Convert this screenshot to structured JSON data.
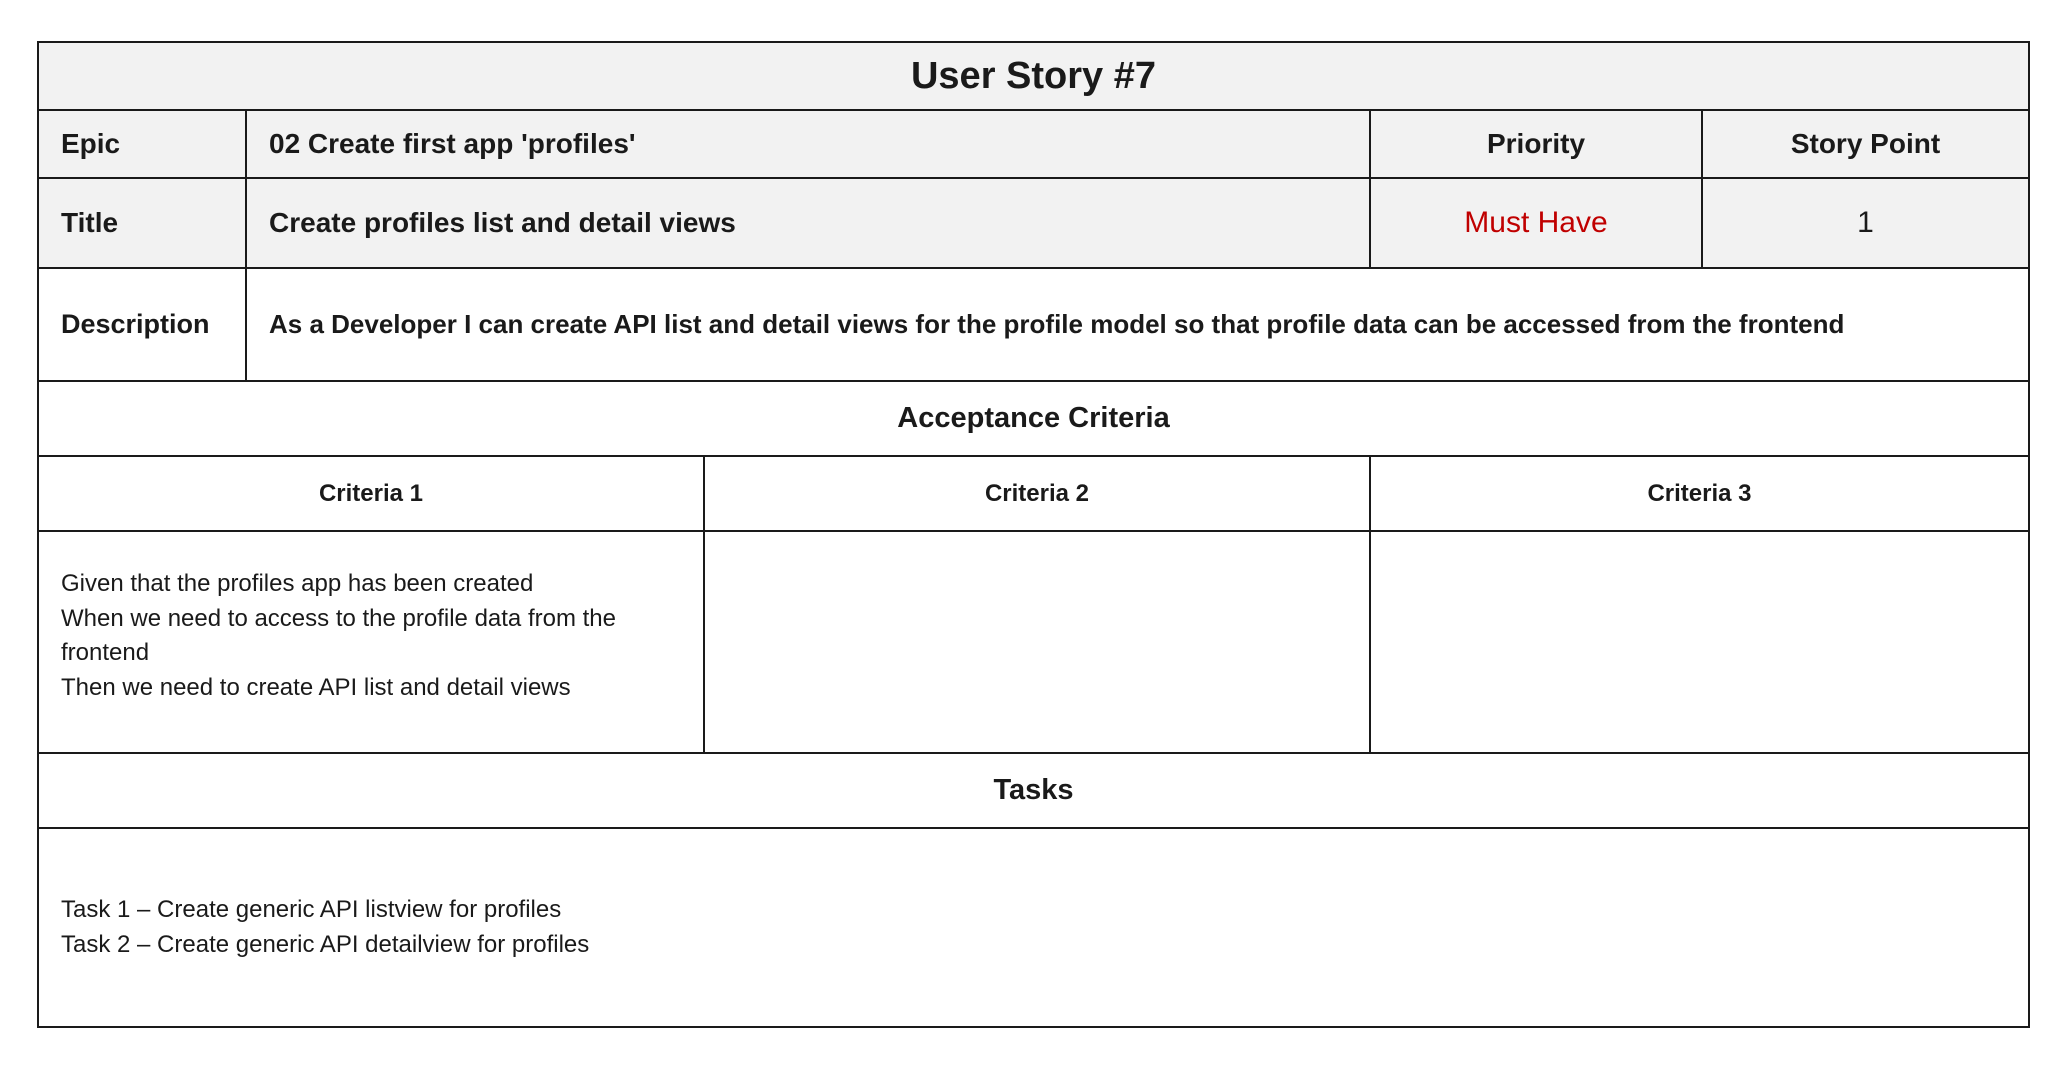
{
  "story": {
    "title": "User Story #7",
    "epic_label": "Epic",
    "epic_value": "02 Create first app 'profiles'",
    "priority_label": "Priority",
    "story_point_label": "Story Point",
    "title_label": "Title",
    "title_value": "Create profiles list and detail views",
    "priority_value": "Must Have",
    "story_point_value": "1",
    "description_label": "Description",
    "description_value": "As a Developer I can create API list and detail views for the profile model so that profile data can be accessed from the frontend",
    "acceptance_header": "Acceptance Criteria",
    "criteria": [
      {
        "header": "Criteria 1",
        "lines": [
          "Given that the profiles app has been created",
          "When we need to access to the profile data from the",
          "frontend",
          "Then we need to create API list and detail views"
        ]
      },
      {
        "header": "Criteria 2",
        "lines": []
      },
      {
        "header": "Criteria 3",
        "lines": []
      }
    ],
    "tasks_header": "Tasks",
    "tasks": [
      "Task 1 – Create generic API listview for profiles",
      "Task 2 – Create generic API detailview for profiles"
    ]
  },
  "colors": {
    "priority_text": "#c00000",
    "header_background": "#f2f2f2",
    "border": "#1a1a1a"
  }
}
